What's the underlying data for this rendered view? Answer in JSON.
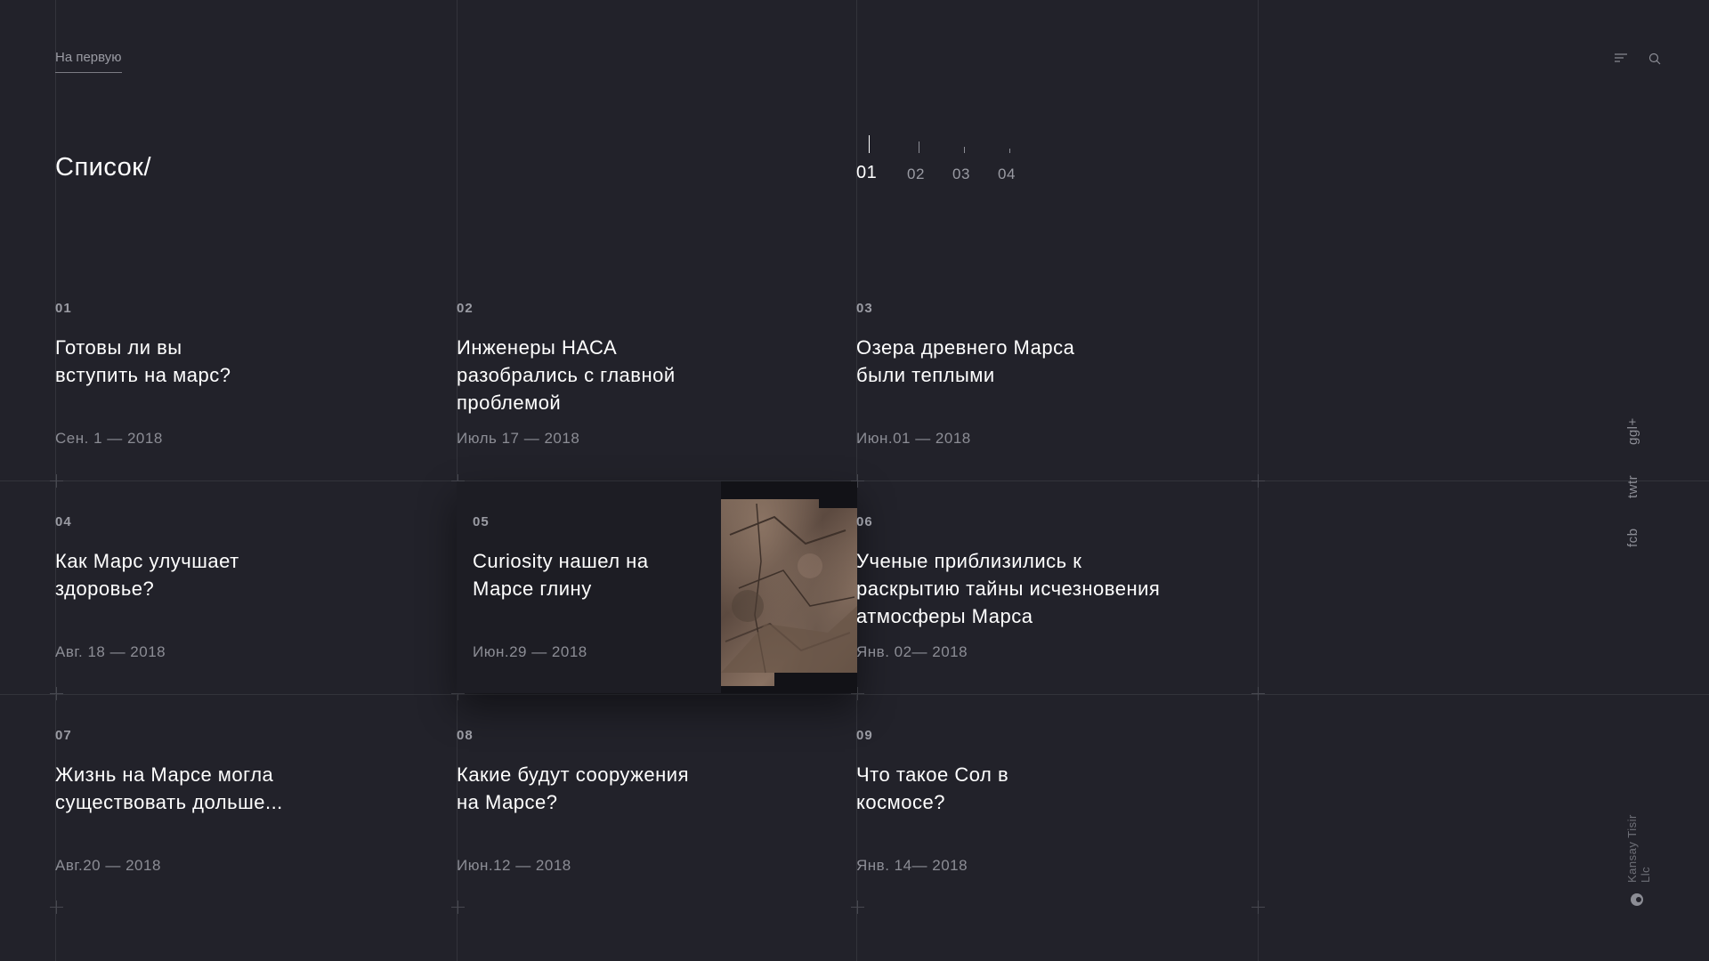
{
  "nav": {
    "home_label": "На первую"
  },
  "page": {
    "title": "Список/"
  },
  "pager": {
    "items": [
      "01",
      "02",
      "03",
      "04"
    ],
    "active": "01"
  },
  "articles": [
    {
      "num": "01",
      "title_lines": [
        "Готовы ли вы",
        "вступить на марс?"
      ],
      "date": "Сен. 1 — 2018"
    },
    {
      "num": "02",
      "title_lines": [
        "Инженеры НАСА",
        "разобрались с главной",
        "проблемой"
      ],
      "date": "Июль 17 — 2018"
    },
    {
      "num": "03",
      "title_lines": [
        "Озера древнего Марса",
        "были теплыми"
      ],
      "date": "Июн.01 — 2018"
    },
    {
      "num": "04",
      "title_lines": [
        "Как Марс улучшает",
        "здоровье?"
      ],
      "date": "Авг. 18 — 2018"
    },
    {
      "num": "05",
      "title_lines": [
        "Curiosity нашел на",
        "Марсе глину"
      ],
      "date": "Июн.29 — 2018"
    },
    {
      "num": "06",
      "title_lines": [
        "Ученые приблизились к",
        "раскрытию тайны исчезновения",
        "атмосферы Марса"
      ],
      "date": "Янв. 02— 2018"
    },
    {
      "num": "07",
      "title_lines": [
        "Жизнь на Марсе могла",
        "существовать дольше..."
      ],
      "date": "Авг.20 — 2018"
    },
    {
      "num": "08",
      "title_lines": [
        "Какие будут сооружения",
        "на Марсе?"
      ],
      "date": "Июн.12 — 2018"
    },
    {
      "num": "09",
      "title_lines": [
        "Что такое Сол в",
        "космосе?"
      ],
      "date": "Янв. 14— 2018"
    }
  ],
  "social": {
    "google": "ggl+",
    "twitter": "twtr",
    "facebook": "fcb"
  },
  "footer": {
    "brand": "Kansay Tisir Llc"
  },
  "colors": {
    "background": "#22222a",
    "grid_line": "#33343b",
    "text_primary": "#ffffff",
    "text_secondary": "#9a9ba3"
  }
}
